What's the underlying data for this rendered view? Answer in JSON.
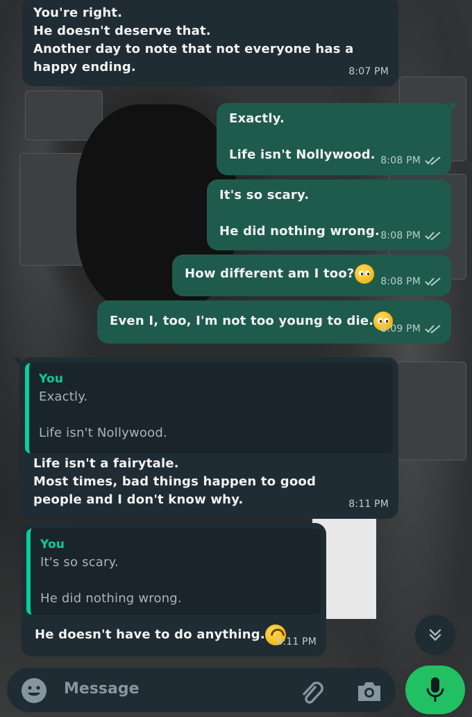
{
  "messages": [
    {
      "id": "m1",
      "direction": "in",
      "text": "You're right.\nHe doesn't deserve that.\nAnother day to note that not everyone has a happy ending.",
      "time": "8:07 PM"
    },
    {
      "id": "m2",
      "direction": "out",
      "text": "Exactly.\n\nLife isn't Nollywood.",
      "time": "8:08 PM",
      "status": "read"
    },
    {
      "id": "m3",
      "direction": "out",
      "text": "It's so scary.\n\nHe did nothing wrong.",
      "time": "8:08 PM",
      "status": "read"
    },
    {
      "id": "m4",
      "direction": "out",
      "text": "How different am I too?",
      "emoji": "pleading-face",
      "time": "8:08 PM",
      "status": "read"
    },
    {
      "id": "m5",
      "direction": "out",
      "text": "Even I, too, I'm not too young to die.",
      "emoji": "pleading-face",
      "time": "8:09 PM",
      "status": "read"
    },
    {
      "id": "m6",
      "direction": "in",
      "quote_author": "You",
      "quote_text": "Exactly.\n\nLife isn't Nollywood.",
      "text": "Life isn't a fairytale.\nMost times, bad things happen to good people and I don't know why.",
      "time": "8:11 PM"
    },
    {
      "id": "m7",
      "direction": "in",
      "quote_author": "You",
      "quote_text": "It's so scary.\n\nHe did nothing wrong.",
      "text": "He doesn't have to do anything.",
      "emoji": "upside-down-face",
      "time": "8:11 PM"
    }
  ],
  "composer": {
    "placeholder": "Message"
  },
  "icons": {
    "emoji_button": "smiley-icon",
    "attach_button": "paperclip-icon",
    "camera_button": "camera-icon",
    "mic_button": "microphone-icon",
    "scroll_down": "double-chevron-down-icon",
    "read_receipt": "double-check-icon"
  },
  "colors": {
    "incoming_bubble": "#1f2c33",
    "outgoing_bubble": "#1e5b4d",
    "accent": "#06cf9c",
    "mic_button": "#21c063"
  }
}
